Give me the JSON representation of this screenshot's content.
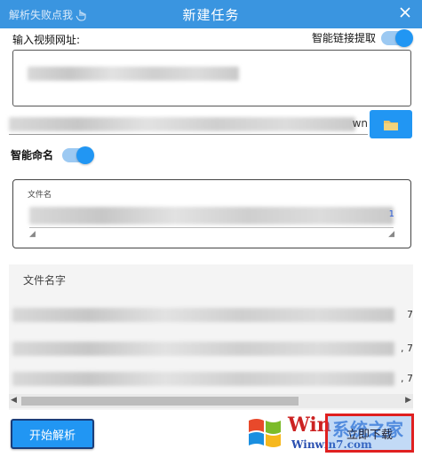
{
  "titlebar": {
    "left_link": "解析失败点我",
    "title": "新建任务"
  },
  "url_section": {
    "label": "输入视频网址:",
    "smart_extract_label": "智能链接提取",
    "smart_extract_on": true
  },
  "save_path": {
    "suffix": "wn"
  },
  "smart_name": {
    "label": "智能命名",
    "on": true
  },
  "filename": {
    "label": "文件名",
    "suffix": "1"
  },
  "file_list": {
    "title": "文件名字",
    "rows": [
      {
        "end": "7"
      },
      {
        "end": ", 7"
      },
      {
        "end": ", 7"
      }
    ]
  },
  "buttons": {
    "start_parse": "开始解析",
    "download_now": "立即下载"
  },
  "watermark": {
    "brand_en": "Win",
    "brand_cn": "系统之家",
    "url": "Winwin7.com"
  },
  "colors": {
    "titlebar": "#3a95e0",
    "accent": "#2196f3",
    "highlight_border": "#e02020"
  }
}
